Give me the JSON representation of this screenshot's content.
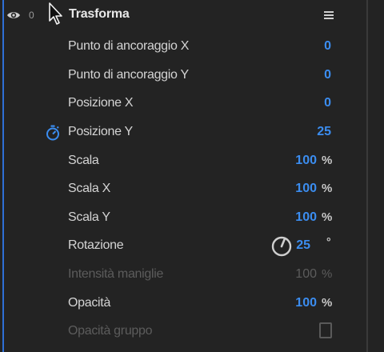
{
  "header": {
    "title": "Trasforma",
    "toggle_label": "0"
  },
  "properties": [
    {
      "label": "Punto di ancoraggio X",
      "value": "0",
      "unit": "",
      "enabled": true
    },
    {
      "label": "Punto di ancoraggio Y",
      "value": "0",
      "unit": "",
      "enabled": true
    },
    {
      "label": "Posizione X",
      "value": "0",
      "unit": "",
      "enabled": true
    },
    {
      "label": "Posizione Y",
      "value": "25",
      "unit": "",
      "enabled": true,
      "keyframed": true
    },
    {
      "label": "Scala",
      "value": "100",
      "unit": "%",
      "enabled": true
    },
    {
      "label": "Scala X",
      "value": "100",
      "unit": "%",
      "enabled": true
    },
    {
      "label": "Scala Y",
      "value": "100",
      "unit": "%",
      "enabled": true
    },
    {
      "label": "Rotazione",
      "value": "25",
      "unit": "°",
      "enabled": true
    },
    {
      "label": "Intensità maniglie",
      "value": "100",
      "unit": "%",
      "enabled": false
    },
    {
      "label": "Opacità",
      "value": "100",
      "unit": "%",
      "enabled": true
    },
    {
      "label": "Opacità gruppo",
      "value": "",
      "unit": "",
      "enabled": false,
      "control": "checkbox",
      "checked": false
    }
  ],
  "colors": {
    "background": "#232323",
    "accent_blue": "#3b8df0",
    "label": "#d4d4d4",
    "disabled": "#5c5c5c"
  },
  "icons": {
    "visibility": "eye-icon",
    "cursor": "cursor-icon",
    "menu": "hamburger-menu-icon",
    "keyframe": "stopwatch-icon",
    "rotation": "rotation-dial-icon"
  }
}
